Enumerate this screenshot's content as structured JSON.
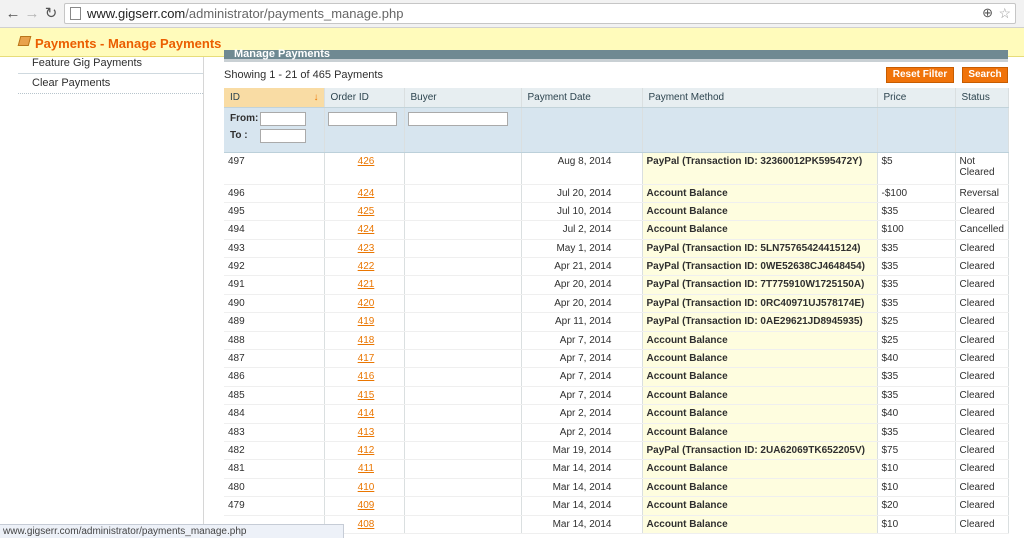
{
  "browser": {
    "url_host": "www.gigserr.com",
    "url_path": "/administrator/payments_manage.php",
    "back_glyph": "←",
    "forward_glyph": "→",
    "refresh_glyph": "↻",
    "zoom_glyph": "⊕",
    "star_glyph": "☆"
  },
  "header": {
    "title": "Payments - Manage Payments",
    "accent_color": "#eb5e00"
  },
  "sidebar": {
    "items": [
      {
        "label": "Feature Gig Payments"
      },
      {
        "label": "Clear Payments"
      }
    ]
  },
  "grid": {
    "title": "Manage Payments",
    "count_text": "Showing 1 - 21 of 465 Payments",
    "reset_label": "Reset Filter",
    "search_label": "Search",
    "sort_glyph": "↓",
    "columns": [
      "ID",
      "Order ID",
      "Buyer",
      "Payment Date",
      "Payment Method",
      "Price",
      "Status"
    ],
    "filter_from": "From:",
    "filter_to": "To :",
    "rows": [
      {
        "id": "497",
        "order": "426",
        "buyer": "",
        "date": "Aug 8, 2014",
        "method": "PayPal (Transaction ID: 32360012PK595472Y)",
        "price": "$5",
        "status": "Not Cleared"
      },
      {
        "id": "496",
        "order": "424",
        "buyer": "",
        "date": "Jul 20, 2014",
        "method": "Account Balance",
        "price": "-$100",
        "status": "Reversal"
      },
      {
        "id": "495",
        "order": "425",
        "buyer": "",
        "date": "Jul 10, 2014",
        "method": "Account Balance",
        "price": "$35",
        "status": "Cleared"
      },
      {
        "id": "494",
        "order": "424",
        "buyer": "",
        "date": "Jul 2, 2014",
        "method": "Account Balance",
        "price": "$100",
        "status": "Cancelled"
      },
      {
        "id": "493",
        "order": "423",
        "buyer": "",
        "date": "May 1, 2014",
        "method": "PayPal (Transaction ID: 5LN75765424415124)",
        "price": "$35",
        "status": "Cleared"
      },
      {
        "id": "492",
        "order": "422",
        "buyer": "",
        "date": "Apr 21, 2014",
        "method": "PayPal (Transaction ID: 0WE52638CJ4648454)",
        "price": "$35",
        "status": "Cleared"
      },
      {
        "id": "491",
        "order": "421",
        "buyer": "",
        "date": "Apr 20, 2014",
        "method": "PayPal (Transaction ID: 7T775910W1725150A)",
        "price": "$35",
        "status": "Cleared"
      },
      {
        "id": "490",
        "order": "420",
        "buyer": "",
        "date": "Apr 20, 2014",
        "method": "PayPal (Transaction ID: 0RC40971UJ578174E)",
        "price": "$35",
        "status": "Cleared"
      },
      {
        "id": "489",
        "order": "419",
        "buyer": "",
        "date": "Apr 11, 2014",
        "method": "PayPal (Transaction ID: 0AE29621JD8945935)",
        "price": "$25",
        "status": "Cleared"
      },
      {
        "id": "488",
        "order": "418",
        "buyer": "",
        "date": "Apr 7, 2014",
        "method": "Account Balance",
        "price": "$25",
        "status": "Cleared"
      },
      {
        "id": "487",
        "order": "417",
        "buyer": "",
        "date": "Apr 7, 2014",
        "method": "Account Balance",
        "price": "$40",
        "status": "Cleared"
      },
      {
        "id": "486",
        "order": "416",
        "buyer": "",
        "date": "Apr 7, 2014",
        "method": "Account Balance",
        "price": "$35",
        "status": "Cleared"
      },
      {
        "id": "485",
        "order": "415",
        "buyer": "",
        "date": "Apr 7, 2014",
        "method": "Account Balance",
        "price": "$35",
        "status": "Cleared"
      },
      {
        "id": "484",
        "order": "414",
        "buyer": "",
        "date": "Apr 2, 2014",
        "method": "Account Balance",
        "price": "$40",
        "status": "Cleared"
      },
      {
        "id": "483",
        "order": "413",
        "buyer": "",
        "date": "Apr 2, 2014",
        "method": "Account Balance",
        "price": "$35",
        "status": "Cleared"
      },
      {
        "id": "482",
        "order": "412",
        "buyer": "",
        "date": "Mar 19, 2014",
        "method": "PayPal (Transaction ID: 2UA62069TK652205V)",
        "price": "$75",
        "status": "Cleared"
      },
      {
        "id": "481",
        "order": "411",
        "buyer": "",
        "date": "Mar 14, 2014",
        "method": "Account Balance",
        "price": "$10",
        "status": "Cleared"
      },
      {
        "id": "480",
        "order": "410",
        "buyer": "",
        "date": "Mar 14, 2014",
        "method": "Account Balance",
        "price": "$10",
        "status": "Cleared"
      },
      {
        "id": "479",
        "order": "409",
        "buyer": "",
        "date": "Mar 14, 2014",
        "method": "Account Balance",
        "price": "$20",
        "status": "Cleared"
      },
      {
        "id": "",
        "order": "408",
        "buyer": "",
        "date": "Mar 14, 2014",
        "method": "Account Balance",
        "price": "$10",
        "status": "Cleared"
      }
    ]
  },
  "status_bar": {
    "text": "www.gigserr.com/administrator/payments_manage.php"
  }
}
